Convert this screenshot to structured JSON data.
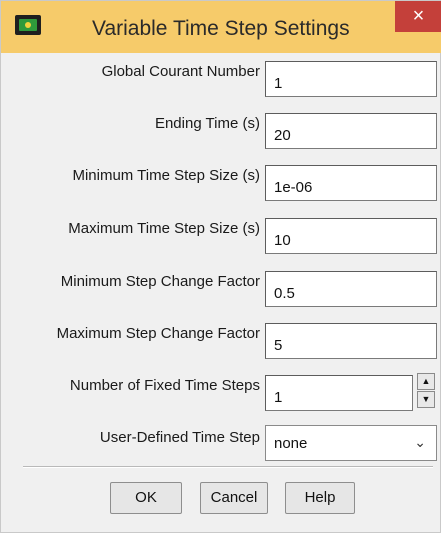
{
  "window": {
    "title": "Variable Time Step Settings",
    "app_icon": "fluent-app-icon",
    "close_icon": "×",
    "colors": {
      "titlebar": "#f6cb6a",
      "close": "#c4403a",
      "background": "#f0f0f0"
    }
  },
  "fields": [
    {
      "label": "Global Courant Number",
      "value": "1"
    },
    {
      "label": "Ending Time (s)",
      "value": "20"
    },
    {
      "label": "Minimum Time Step Size (s)",
      "value": "1e-06"
    },
    {
      "label": "Maximum Time Step Size (s)",
      "value": "10"
    },
    {
      "label": "Minimum Step Change Factor",
      "value": "0.5"
    },
    {
      "label": "Maximum Step Change Factor",
      "value": "5"
    },
    {
      "label": "Number of Fixed Time Steps",
      "value": "1",
      "up_icon": "▲",
      "down_icon": "▼"
    },
    {
      "label": "User-Defined Time Step",
      "value": "none",
      "chevron_icon": "⌄"
    }
  ],
  "buttons": {
    "ok": "OK",
    "cancel": "Cancel",
    "help": "Help"
  }
}
